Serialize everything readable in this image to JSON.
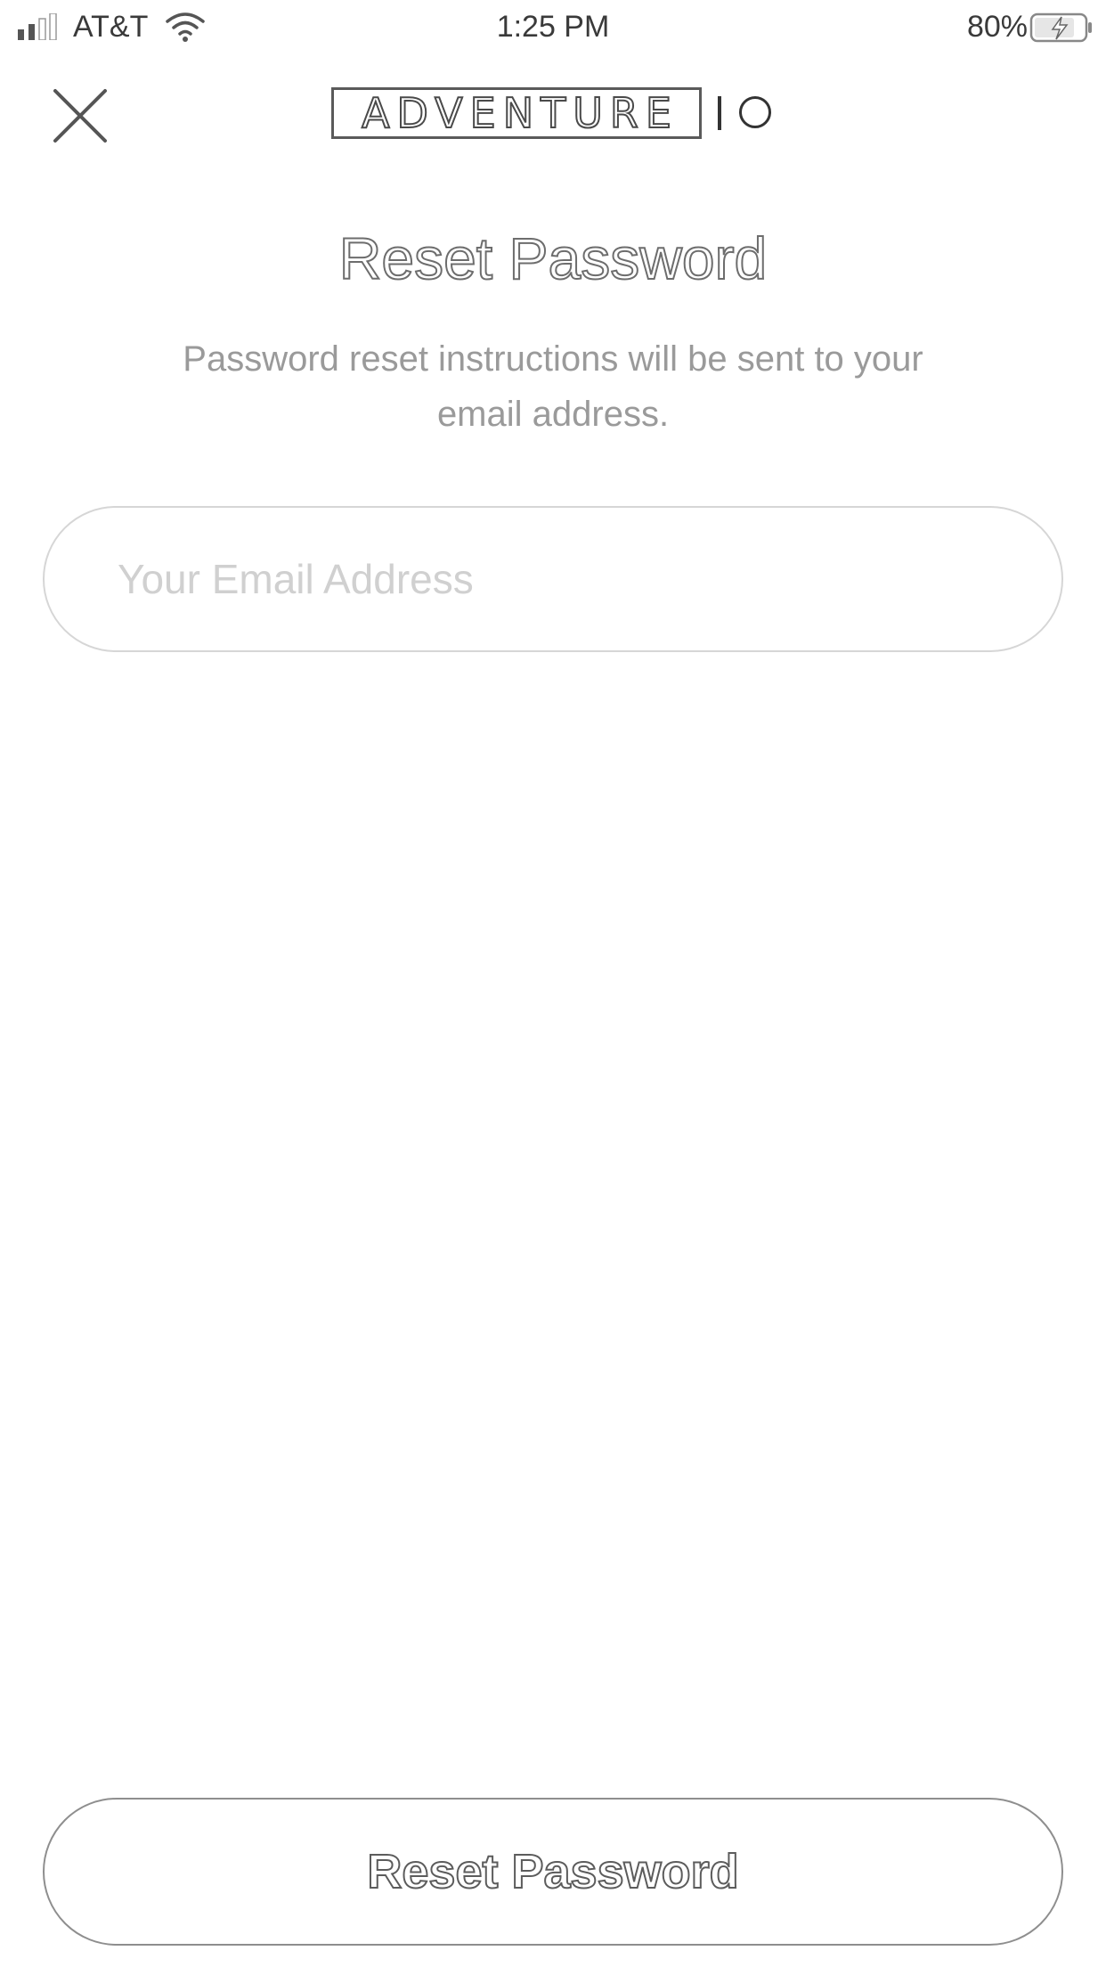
{
  "status_bar": {
    "carrier": "AT&T",
    "time": "1:25 PM",
    "battery_percent": "80%",
    "signal_bars_filled": 2,
    "signal_bars_total": 4,
    "battery_level": 0.8,
    "charging": true
  },
  "header": {
    "close_icon": "close-icon",
    "logo_text": "ADVENTURE",
    "logo_mark": "circle"
  },
  "main": {
    "title": "Reset Password",
    "subtitle": "Password reset instructions will be sent to your email address."
  },
  "form": {
    "email": {
      "value": "",
      "placeholder": "Your Email Address"
    },
    "submit_label": "Reset Password"
  },
  "colors": {
    "background": "#ffffff",
    "text_primary": "#3a3a3a",
    "text_secondary": "#9a9a9a",
    "placeholder": "#d0d0d0",
    "field_border": "#d6d6d6",
    "button_border": "#8e8e8e"
  }
}
